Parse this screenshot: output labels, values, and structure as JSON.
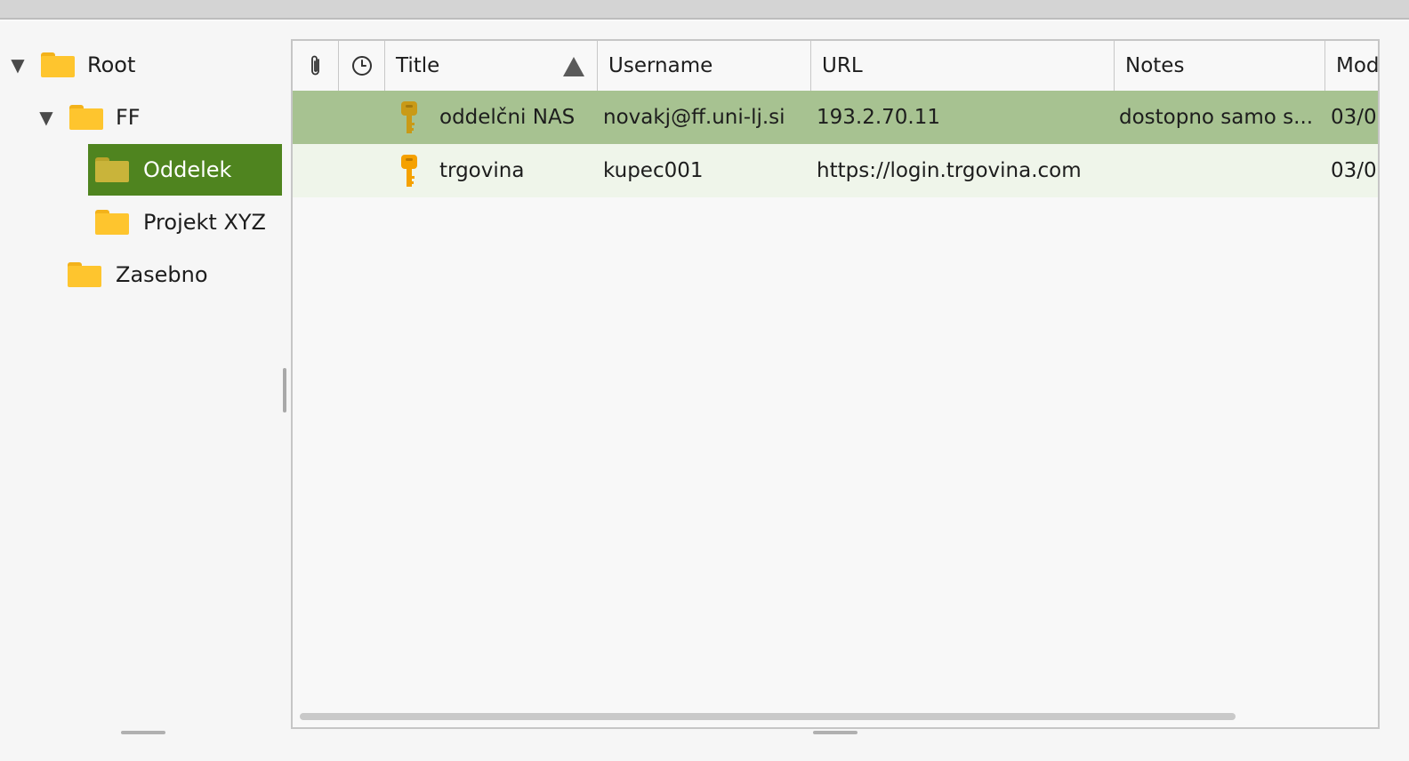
{
  "colors": {
    "accent_selected": "#4f841f",
    "row_selected": "#a7c291",
    "row_alt": "#eff5ea",
    "folder": "#fec52e",
    "key": "#f5a100"
  },
  "tree": {
    "root": {
      "label": "Root",
      "expanded": true,
      "icon": "folder-icon"
    },
    "ff": {
      "label": "FF",
      "expanded": true,
      "icon": "folder-icon"
    },
    "oddelek": {
      "label": "Oddelek",
      "selected": true,
      "icon": "folder-icon"
    },
    "projekt": {
      "label": "Projekt XYZ",
      "icon": "folder-icon"
    },
    "zasebno": {
      "label": "Zasebno",
      "icon": "folder-icon"
    }
  },
  "table": {
    "columns": {
      "attachment": {
        "icon": "paperclip-icon"
      },
      "expiry": {
        "icon": "clock-icon"
      },
      "title": "Title",
      "username": "Username",
      "url": "URL",
      "notes": "Notes",
      "modified": "Mod"
    },
    "sort": {
      "column": "title",
      "direction": "ascending"
    },
    "rows": [
      {
        "icon": "key-icon",
        "title": "oddelčni NAS",
        "username": "novakj@ff.uni-lj.si",
        "url": "193.2.70.11",
        "notes": "dostopno samo s...",
        "modified": "03/0",
        "selected": true
      },
      {
        "icon": "key-icon",
        "title": "trgovina",
        "username": "kupec001",
        "url": "https://login.trgovina.com",
        "notes": "",
        "modified": "03/0",
        "selected": false
      }
    ]
  }
}
